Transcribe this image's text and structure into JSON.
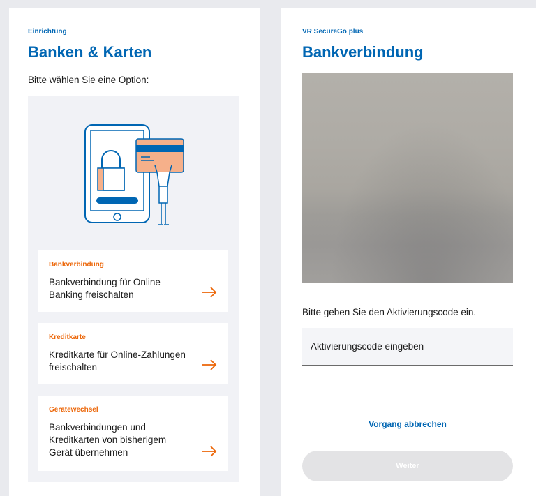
{
  "left": {
    "eyebrow": "Einrichtung",
    "title": "Banken & Karten",
    "prompt": "Bitte wählen Sie eine Option:",
    "options": [
      {
        "label": "Bankverbindung",
        "text": "Bankverbindung für Online Banking freischalten"
      },
      {
        "label": "Kreditkarte",
        "text": "Kreditkarte für Online-Zahlungen freischalten"
      },
      {
        "label": "Gerätewechsel",
        "text": "Bankverbindungen und Kreditkarten von bisherigem Gerät übernehmen"
      }
    ]
  },
  "right": {
    "eyebrow": "VR SecureGo plus",
    "title": "Bankverbindung",
    "code_prompt": "Bitte geben Sie den Aktivierungscode ein.",
    "code_input": {
      "placeholder": "Aktivierungscode eingeben",
      "value": ""
    },
    "cancel_label": "Vorgang abbrechen",
    "next_label": "Weiter",
    "next_enabled": false
  },
  "colors": {
    "brand_blue": "#0066b3",
    "accent_orange": "#ec6608",
    "page_background": "#e9eaee",
    "option_area": "#f1f2f6"
  },
  "icons": {
    "illustration": "phone-padlock-creditcard-illustration",
    "option_arrow": "arrow-right-icon"
  }
}
